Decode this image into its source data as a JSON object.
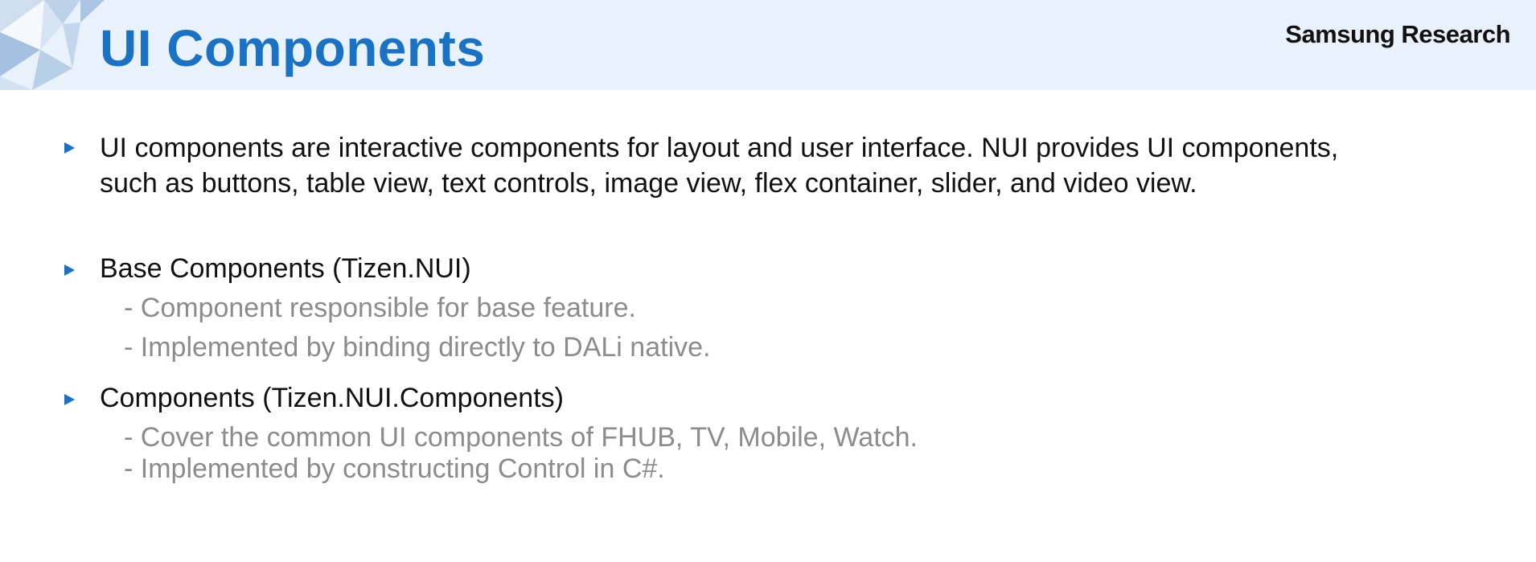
{
  "header": {
    "title": "UI Components",
    "brand": "Samsung Research"
  },
  "bullets": [
    {
      "lines": [
        "UI components are interactive components for layout and user interface. NUI provides UI components,",
        "such as buttons, table view, text controls, image view, flex container, slider, and video view."
      ]
    },
    {
      "label": "Base Components (Tizen.NUI)",
      "sub": [
        "- Component responsible for base feature.",
        "- Implemented by binding directly to DALi native."
      ]
    },
    {
      "label": "Components (Tizen.NUI.Components)",
      "sub": [
        "- Cover the common UI components of FHUB, TV, Mobile, Watch.",
        "- Implemented by constructing Control in C#."
      ]
    }
  ],
  "colors": {
    "title": "#1a72c4",
    "bullet": "#1a72c4",
    "header_bg": "#e9f1fa",
    "sub_text": "#8c8c8c"
  },
  "icons": {
    "bullet": "triangle-right-icon",
    "decoration": "triangle-pattern"
  }
}
